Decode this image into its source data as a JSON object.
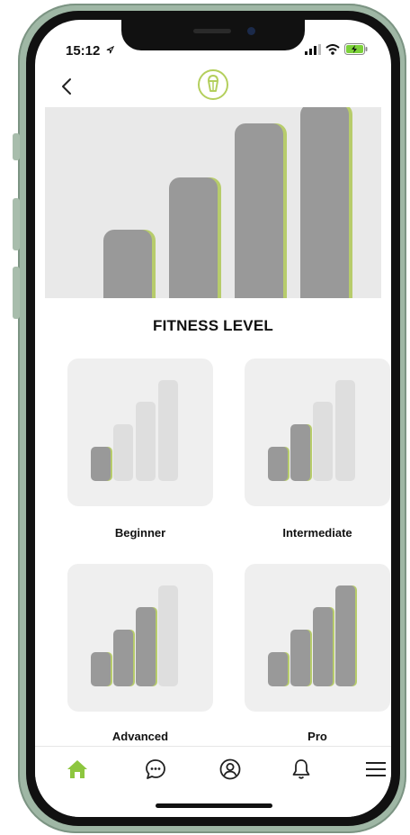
{
  "status_bar": {
    "time": "15:12",
    "icons": [
      "location-arrow-icon",
      "signal-icon",
      "wifi-icon",
      "battery-charging-icon"
    ]
  },
  "header": {
    "back_icon": "chevron-left-icon",
    "logo_icon": "kettlebell-logo-icon"
  },
  "hero": {
    "levels": [
      0.35,
      0.62,
      0.9,
      1.0
    ]
  },
  "section_title": "FITNESS LEVEL",
  "levels": [
    {
      "label": "Beginner",
      "filled": 1
    },
    {
      "label": "Intermediate",
      "filled": 2
    },
    {
      "label": "Advanced",
      "filled": 3
    },
    {
      "label": "Pro",
      "filled": 4
    }
  ],
  "tab_bar": {
    "items": [
      {
        "icon": "home-icon",
        "active": true
      },
      {
        "icon": "chat-icon",
        "active": false
      },
      {
        "icon": "profile-icon",
        "active": false
      },
      {
        "icon": "bell-icon",
        "active": false
      },
      {
        "icon": "menu-icon",
        "active": false
      }
    ]
  },
  "colors": {
    "accent": "#8dc63f",
    "bar_filled": "#999999",
    "bar_empty": "#dedede",
    "card_bg": "#efefef",
    "hero_bg": "#e9e9e9"
  }
}
